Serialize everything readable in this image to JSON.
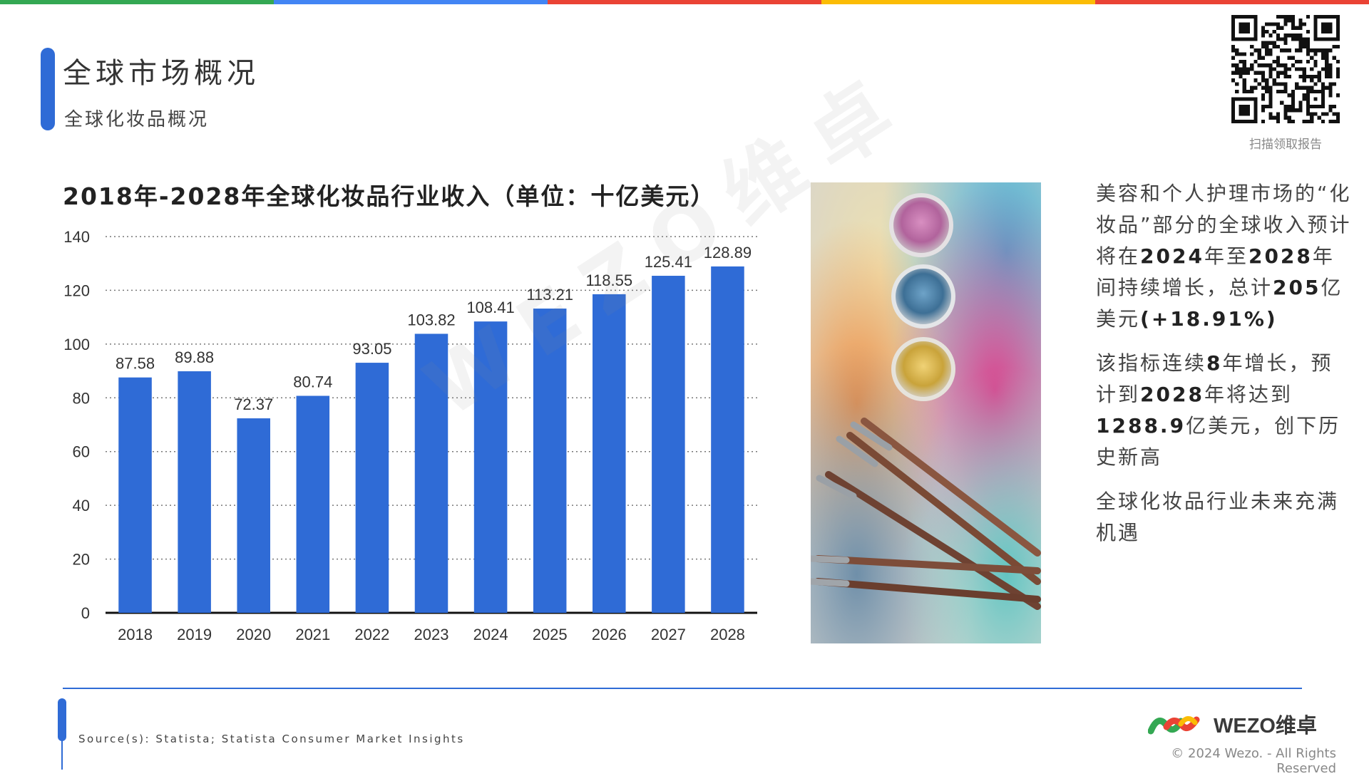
{
  "header": {
    "title": "全球市场概况",
    "subtitle": "全球化妆品概况"
  },
  "qr": {
    "caption": "扫描领取报告",
    "icon": "qr-code-icon"
  },
  "colors": {
    "accent": "#2f6bd6",
    "bar": "#2f6bd6",
    "top_stripe": [
      "#34a853",
      "#4285f4",
      "#ea4335",
      "#fbbc05",
      "#ea4335"
    ]
  },
  "chart_data": {
    "type": "bar",
    "title": "2018年-2028年全球化妆品行业收入（单位：十亿美元）",
    "categories": [
      "2018",
      "2019",
      "2020",
      "2021",
      "2022",
      "2023",
      "2024",
      "2025",
      "2026",
      "2027",
      "2028"
    ],
    "values": [
      87.58,
      89.88,
      72.37,
      80.74,
      93.05,
      103.82,
      108.41,
      113.21,
      118.55,
      125.41,
      128.89
    ],
    "data_labels": [
      "87.58",
      "89.88",
      "72.37",
      "80.74",
      "93.05",
      "103.82",
      "108.41",
      "113.21",
      "118.55",
      "125.41",
      "128.89"
    ],
    "yticks": [
      "0",
      "20",
      "40",
      "60",
      "80",
      "100",
      "120",
      "140"
    ],
    "ylim": [
      0,
      140
    ],
    "xlabel": "",
    "ylabel": "",
    "grid": true,
    "grid_style": "dotted",
    "legend": "none"
  },
  "watermark": "WEZO维卓",
  "side": {
    "p1": {
      "a": "美容和个人护理市场的“化妆品”部分的全球收入预计将在",
      "b": "2024",
      "c": "年至",
      "d": "2028",
      "e": "年间持续增长，总计",
      "f": "205",
      "g": "亿美元",
      "h": "(+18.91%)"
    },
    "p2": {
      "a": "该指标连续",
      "b": "8",
      "c": "年增长，预计到",
      "d": "2028",
      "e": "年将达到",
      "f": "1288.9",
      "g": "亿美元，创下历史新高"
    },
    "p3": "全球化妆品行业未来充满机遇"
  },
  "footer": {
    "source": "Source(s): Statista; Statista Consumer Market Insights",
    "logo_text": "WEZO维卓",
    "copyright": "© 2024 Wezo. - All Rights Reserved"
  }
}
